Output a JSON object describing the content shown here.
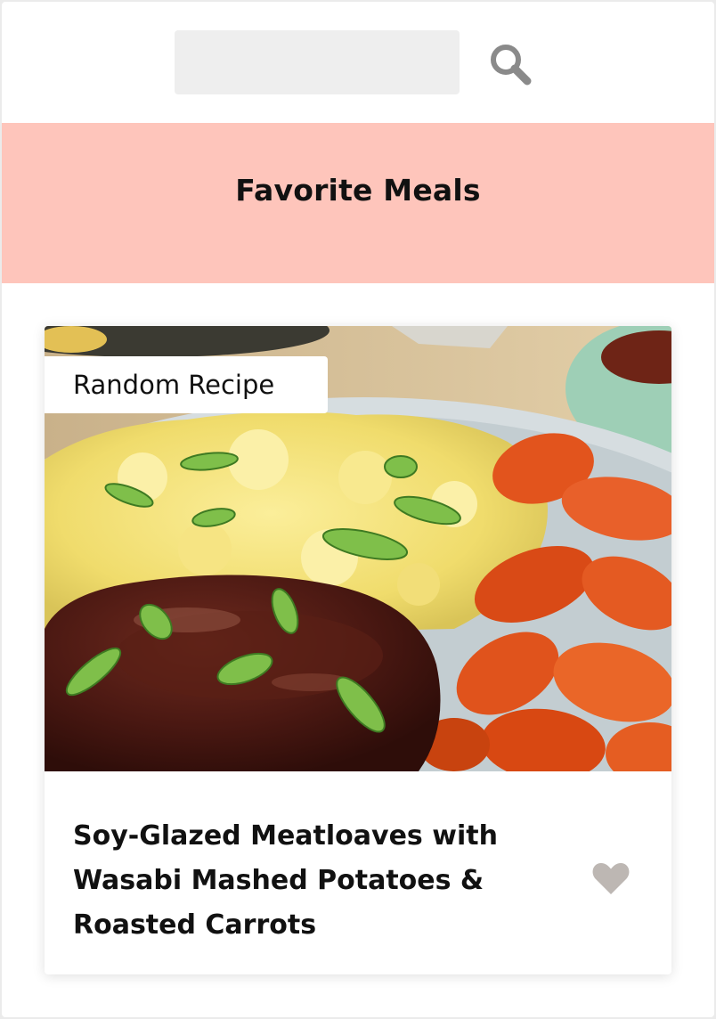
{
  "search": {
    "placeholder": "",
    "value": "",
    "button_icon": "search-icon"
  },
  "favorites": {
    "title": "Favorite Meals"
  },
  "meal": {
    "tag": "Random Recipe",
    "title": "Soy-Glazed Meatloaves with Wasabi Mashed Potatoes & Roasted Carrots",
    "image_alt": "Soy-glazed meatloaf with mashed potatoes and roasted carrots",
    "favorite_icon": "heart-icon",
    "favorited": false
  },
  "colors": {
    "header_bg": "#fec5bb",
    "input_bg": "#eeeeee",
    "icon_gray": "#8a8a8a",
    "heart_gray": "#bdb7b3"
  }
}
